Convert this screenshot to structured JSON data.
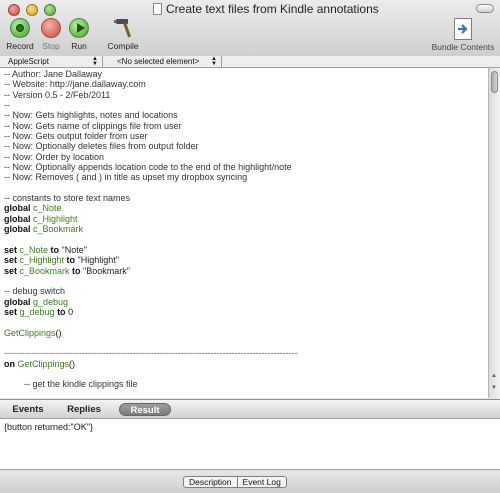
{
  "window": {
    "title": "Create text files from Kindle annotations"
  },
  "toolbar": {
    "record": "Record",
    "stop": "Stop",
    "run": "Run",
    "compile": "Compile",
    "bundle": "Bundle Contents"
  },
  "navbar": {
    "language": "AppleScript",
    "element": "<No selected element>"
  },
  "code": [
    [
      [
        "cmt",
        "-- Author: Jane Dallaway"
      ]
    ],
    [
      [
        "cmt",
        "-- Website: http://jane.dallaway.com"
      ]
    ],
    [
      [
        "cmt",
        "-- Version 0.5 - 2/Feb/2011"
      ]
    ],
    [
      [
        "cmt",
        "--"
      ]
    ],
    [
      [
        "cmt",
        "-- Now: Gets highlights, notes and locations"
      ]
    ],
    [
      [
        "cmt",
        "-- Now: Gets name of clippings file from user"
      ]
    ],
    [
      [
        "cmt",
        "-- Now: Gets output folder from user"
      ]
    ],
    [
      [
        "cmt",
        "-- Now: Optionally deletes files from output folder"
      ]
    ],
    [
      [
        "cmt",
        "-- Now: Order by location"
      ]
    ],
    [
      [
        "cmt",
        "-- Now: Optionally appends location code to the end of the highlight/note"
      ]
    ],
    [
      [
        "cmt",
        "-- Now: Removes ( and ) in title as upset my dropbox syncing"
      ]
    ],
    [],
    [
      [
        "cmt",
        "-- constants to store text names"
      ]
    ],
    [
      [
        "kw",
        "global "
      ],
      [
        "var",
        "c_Note"
      ]
    ],
    [
      [
        "kw",
        "global "
      ],
      [
        "var",
        "c_Highlight"
      ]
    ],
    [
      [
        "kw",
        "global "
      ],
      [
        "var",
        "c_Bookmark"
      ]
    ],
    [],
    [
      [
        "kw",
        "set "
      ],
      [
        "var",
        "c_Note"
      ],
      [
        "kw",
        " to "
      ],
      [
        "str",
        "\"Note\""
      ]
    ],
    [
      [
        "kw",
        "set "
      ],
      [
        "var",
        "c_Highlight"
      ],
      [
        "kw",
        " to "
      ],
      [
        "str",
        "\"Highlight\""
      ]
    ],
    [
      [
        "kw",
        "set "
      ],
      [
        "var",
        "c_Bookmark"
      ],
      [
        "kw",
        " to "
      ],
      [
        "str",
        "\"Bookmark\""
      ]
    ],
    [],
    [
      [
        "cmt",
        "-- debug switch"
      ]
    ],
    [
      [
        "kw",
        "global "
      ],
      [
        "var",
        "g_debug"
      ]
    ],
    [
      [
        "kw",
        "set "
      ],
      [
        "var",
        "g_debug"
      ],
      [
        "kw",
        " to "
      ],
      [
        "str",
        "0"
      ]
    ],
    [],
    [
      [
        "var",
        "GetClippings"
      ],
      [
        "str",
        "()"
      ]
    ],
    [],
    [
      [
        "sep",
        "--------------------------------------------------------------------------------------------------"
      ]
    ],
    [
      [
        "kw",
        "on "
      ],
      [
        "var",
        "GetClippings"
      ],
      [
        "str",
        "()"
      ]
    ],
    [],
    [
      [
        "cmt",
        "        -- get the kindle clippings file"
      ]
    ]
  ],
  "results": {
    "tabs": [
      "Events",
      "Replies",
      "Result"
    ],
    "active": "Result",
    "text": "{button returned:\"OK\"}"
  },
  "bottom": {
    "description": "Description",
    "event_log": "Event Log"
  }
}
